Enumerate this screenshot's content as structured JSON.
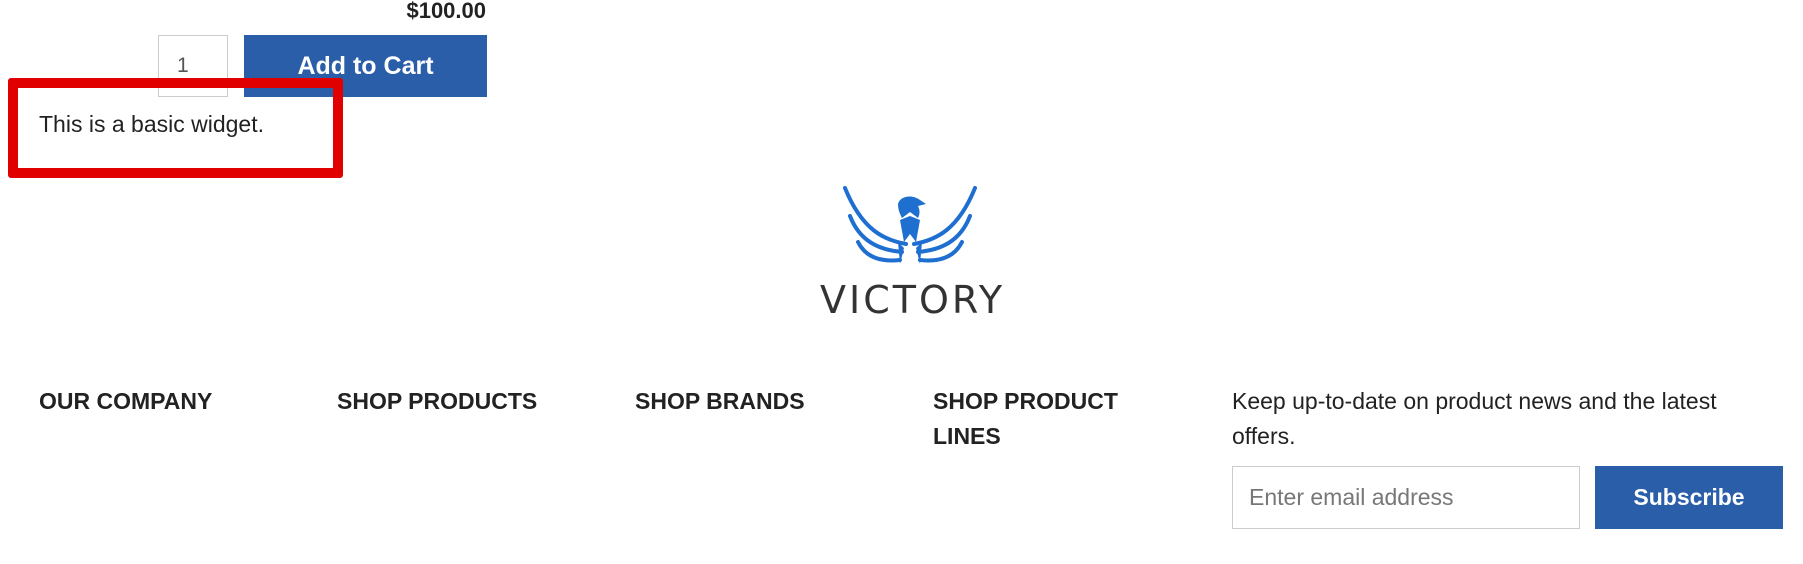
{
  "product": {
    "price": "$100.00",
    "quantity": "1",
    "add_to_cart_label": "Add to Cart"
  },
  "widget": {
    "text": "This is a basic widget."
  },
  "logo": {
    "icon": "eagle-wings-icon",
    "text": "VICTORY",
    "color": "#1e6fcf"
  },
  "footer": {
    "columns": [
      {
        "title": "OUR COMPANY"
      },
      {
        "title": "SHOP PRODUCTS"
      },
      {
        "title": "SHOP BRANDS"
      },
      {
        "title": "SHOP PRODUCT LINES"
      }
    ],
    "newsletter": {
      "text": "Keep up-to-date on product news and the latest offers.",
      "email_placeholder": "Enter email address",
      "subscribe_label": "Subscribe"
    }
  },
  "colors": {
    "button": "#2a5ea9",
    "highlight": "#e00000"
  }
}
